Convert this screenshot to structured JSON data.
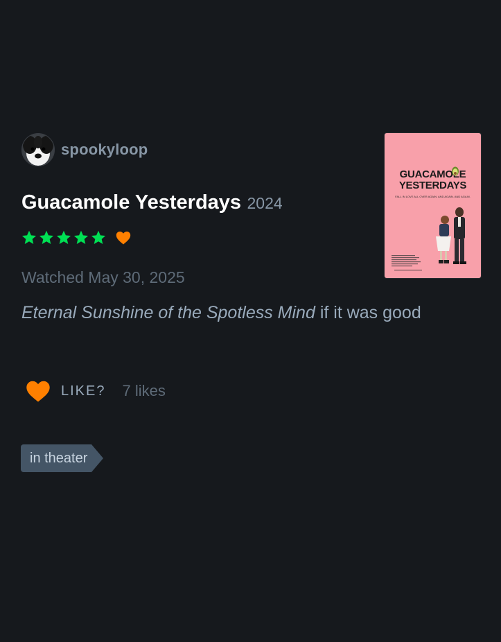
{
  "author": {
    "username": "spookyloop",
    "avatar_icon": "dog-avatar"
  },
  "film": {
    "title": "Guacamole Yesterdays",
    "year": "2024",
    "poster": {
      "title_line1": "GUACAMOLE",
      "title_line2": "YESTERDAYS",
      "tagline": "FALL IN LOVE ALL OVER AGAIN. AND AGAIN. AND AGAIN.",
      "background": "#f8a0aa"
    }
  },
  "review": {
    "rating_stars": 5,
    "liked": true,
    "watched_text": "Watched May 30, 2025",
    "text_italic": "Eternal Sunshine of the Spotless Mind",
    "text_rest": " if it was good"
  },
  "likes": {
    "label": "LIKE?",
    "count_text": "7 likes"
  },
  "tags": [
    "in theater"
  ],
  "colors": {
    "background": "#16191d",
    "star_green": "#00e054",
    "heart_orange": "#ff8000",
    "muted_text": "#8796a5",
    "tag_bg": "#445566"
  }
}
